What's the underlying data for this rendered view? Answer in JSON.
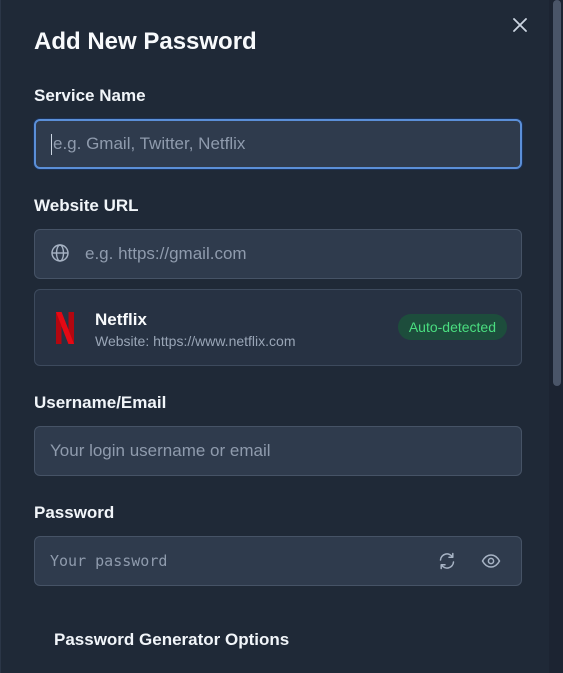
{
  "modal": {
    "title": "Add New Password",
    "close_icon": "close-icon"
  },
  "service": {
    "label": "Service Name",
    "placeholder": "e.g. Gmail, Twitter, Netflix",
    "value": ""
  },
  "website": {
    "label": "Website URL",
    "placeholder": "e.g. https://gmail.com",
    "icon": "globe-icon"
  },
  "detected": {
    "name": "Netflix",
    "site": "Website: https://www.netflix.com",
    "badge": "Auto-detected",
    "logo_color": "#e50914",
    "badge_color": "#4ade80"
  },
  "username": {
    "label": "Username/Email",
    "placeholder": "Your login username or email"
  },
  "password": {
    "label": "Password",
    "placeholder": "Your password",
    "icons": [
      "refresh-icon",
      "eye-icon"
    ]
  },
  "generator": {
    "title": "Password Generator Options"
  },
  "colors": {
    "background": "#1f2937",
    "input": "#2f3b4d",
    "focus": "#5b8fd8"
  }
}
